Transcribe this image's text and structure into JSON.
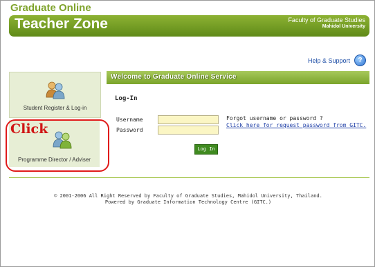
{
  "header": {
    "small_title": "Graduate Online",
    "main_title": "Teacher Zone",
    "faculty": "Faculty of Graduate Studies",
    "university": "Mahidol University"
  },
  "help": {
    "label": "Help & Support",
    "icon": "help-question-icon"
  },
  "left": {
    "student_label": "Student Register & Log-in",
    "director_label": "Programme Director / Adviser",
    "annotation": "Click"
  },
  "main": {
    "welcome_banner": "Welcome to Graduate Online Service",
    "login_title": "Log-In",
    "username_label": "Username",
    "password_label": "Password",
    "username_value": "",
    "password_value": "",
    "forgot_text": "Forgot username or password ?",
    "forgot_link": "Click here for request password from GITC.",
    "login_button": "Log In"
  },
  "footer": {
    "line1": "© 2001-2006 All Right Reserved by Faculty of Graduate Studies, Mahidol University, Thailand.",
    "line2": "Powered by Graduate Information Technology Centre (GITC.)"
  },
  "colors": {
    "brand_green": "#6e9a22",
    "annotation_red": "#e01b1b",
    "input_yellow": "#fbf6c4"
  }
}
